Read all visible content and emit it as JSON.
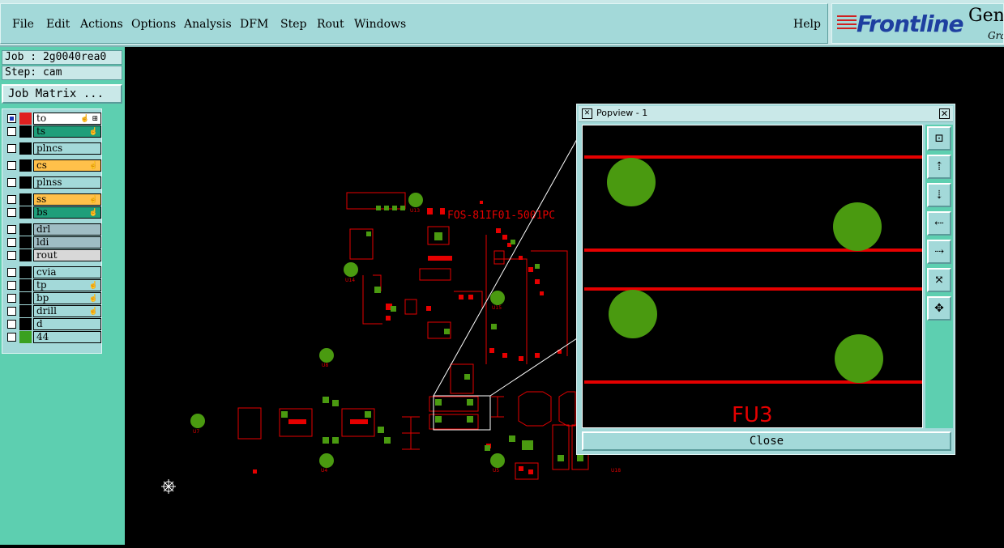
{
  "menubar": {
    "items": [
      "File",
      "Edit",
      "Actions",
      "Options",
      "Analysis",
      "DFM",
      "Step",
      "Rout",
      "Windows"
    ],
    "help": "Help"
  },
  "brand": {
    "logo": "Frontline",
    "product": "Gen",
    "sub": "Gra"
  },
  "sidebar": {
    "job": "Job : 2g0040rea0",
    "step": "Step: cam",
    "matrix_button": "Job Matrix ...",
    "layers": [
      {
        "name": "to",
        "color": "#e02020",
        "bg": "#ffffff",
        "checked": true,
        "hand": "☝ ⊞"
      },
      {
        "name": "ts",
        "color": "#000000",
        "bg": "#1f9e7a",
        "checked": false,
        "hand": "☝"
      },
      {
        "name": "plncs",
        "color": "#000000",
        "bg": "#a3d9d9",
        "checked": false,
        "hand": ""
      },
      {
        "name": "cs",
        "color": "#000000",
        "bg": "#ffc04a",
        "checked": false,
        "hand": "☝"
      },
      {
        "name": "plnss",
        "color": "#000000",
        "bg": "#a3d9d9",
        "checked": false,
        "hand": ""
      },
      {
        "name": "ss",
        "color": "#000000",
        "bg": "#ffc04a",
        "checked": false,
        "hand": "☝"
      },
      {
        "name": "bs",
        "color": "#000000",
        "bg": "#1f9e7a",
        "checked": false,
        "hand": "☝"
      },
      {
        "name": "drl",
        "color": "#000000",
        "bg": "#9fbdc4",
        "checked": false,
        "hand": ""
      },
      {
        "name": "ldi",
        "color": "#000000",
        "bg": "#9fbdc4",
        "checked": false,
        "hand": ""
      },
      {
        "name": "rout",
        "color": "#000000",
        "bg": "#d8d8d8",
        "checked": false,
        "hand": ""
      },
      {
        "name": "cvia",
        "color": "#000000",
        "bg": "#a3d9d9",
        "checked": false,
        "hand": ""
      },
      {
        "name": "tp",
        "color": "#000000",
        "bg": "#a3d9d9",
        "checked": false,
        "hand": "☝"
      },
      {
        "name": "bp",
        "color": "#000000",
        "bg": "#a3d9d9",
        "checked": false,
        "hand": "☝"
      },
      {
        "name": "drill",
        "color": "#000000",
        "bg": "#a3d9d9",
        "checked": false,
        "hand": "☝"
      },
      {
        "name": "d",
        "color": "#000000",
        "bg": "#a3d9d9",
        "checked": false,
        "hand": ""
      },
      {
        "name": "44",
        "color": "#3aa020",
        "bg": "#a3d9d9",
        "checked": false,
        "hand": ""
      }
    ]
  },
  "canvas": {
    "board_label": "FOS-81IF01-5001PC",
    "refdes": [
      "U13",
      "U14",
      "U15",
      "U8",
      "U7",
      "U4",
      "U5",
      "U18"
    ]
  },
  "popview": {
    "title": "Popview - 1",
    "component_label": "FU3",
    "close": "Close"
  },
  "colors": {
    "trace": "#e60000",
    "pad": "#4a9a10",
    "panel": "#a3d9d9",
    "sidebar": "#5dcfb0"
  }
}
